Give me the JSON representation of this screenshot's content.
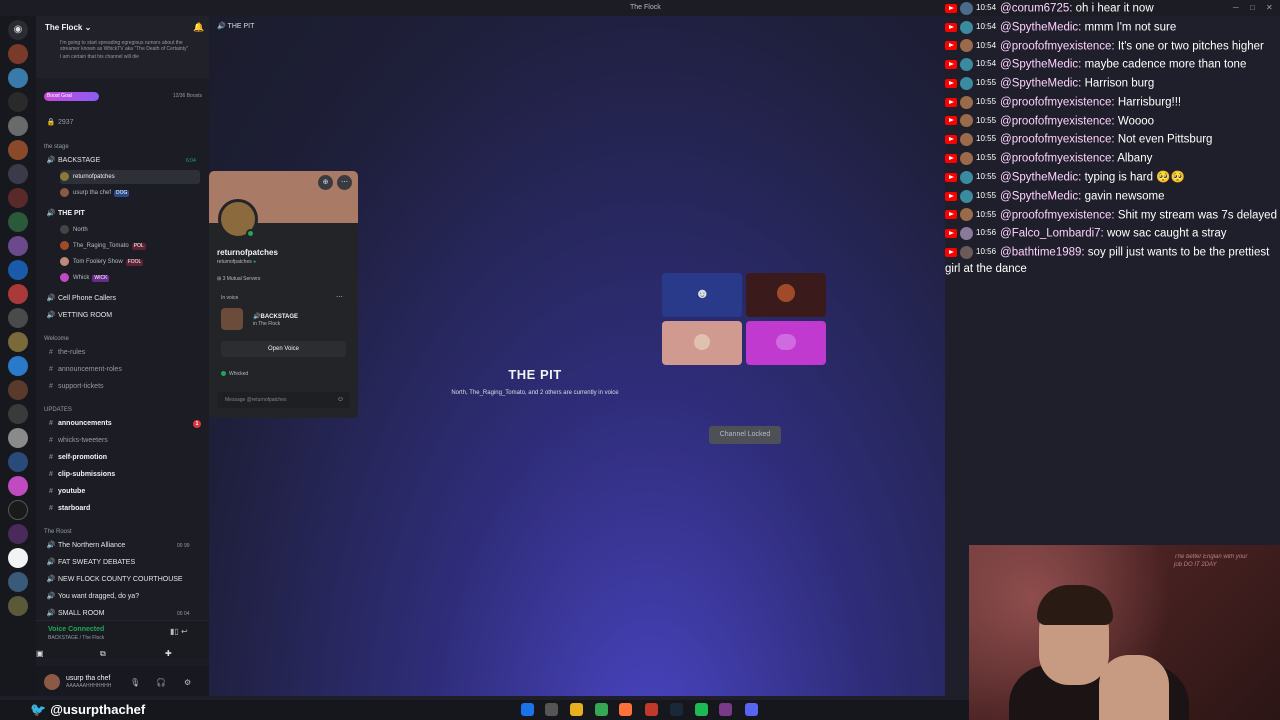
{
  "window": {
    "title": "The Flock"
  },
  "server": {
    "name": "The Flock",
    "event_text": "I'm going to start spreading egregious rumors about the streamer known as WhickTV aka \"The Death of Certainty\"",
    "event_text2": "I am certain that his channel will die",
    "boost_label": "Boost Goal",
    "boost_count": "12/36 Boosts",
    "boost_progress": 0.33
  },
  "sidebar": {
    "member_count": "2937",
    "cat_stage": "the stage",
    "backstage": {
      "label": "BACKSTAGE",
      "time": "6:04"
    },
    "backstage_users": [
      {
        "name": "returnofpatches",
        "tag": ""
      },
      {
        "name": "usurp tha chef",
        "tag": "DOG"
      }
    ],
    "thepit": {
      "label": "THE PIT"
    },
    "pit_users": [
      {
        "name": "North",
        "tag": ""
      },
      {
        "name": "The_Raging_Tomato",
        "tag": "POL"
      },
      {
        "name": "Tom Foolery Show",
        "tag": "FOOL"
      },
      {
        "name": "Whick",
        "tag": "WICK"
      }
    ],
    "voice_channels_a": [
      "Cell Phone Callers",
      "VETTING ROOM"
    ],
    "cat_welcome": "Welcome",
    "welcome_channels": [
      "the-rules",
      "announcement-roles",
      "support-tickets"
    ],
    "cat_updates": "UPDATES",
    "update_channels": [
      "announcements",
      "whicks-tweeters",
      "self-promotion",
      "clip-submissions",
      "youtube",
      "starboard"
    ],
    "cat_roost": "The Roost",
    "roost_channels": [
      "The Northern Alliance",
      "FAT SWEATY DEBATES",
      "NEW FLOCK COUNTY COURTHOUSE",
      "You want dragged, do ya?",
      "SMALL ROOM"
    ],
    "roost_counts": [
      "00 99",
      "00 04"
    ]
  },
  "voice": {
    "status": "Voice Connected",
    "location": "BACKSTAGE / The Flock"
  },
  "user": {
    "name": "usurp tha chef",
    "status": "AAAAAAHHHHHHH"
  },
  "main": {
    "channel": "THE PIT",
    "title": "THE PIT",
    "subtitle": "North, The_Raging_Tomato, and 2 others are currently in voice",
    "locked": "Channel Locked"
  },
  "popout": {
    "name": "returnofpatches",
    "handle": "returnofpatches",
    "mutual": "3 Mutual Servers",
    "in_voice_label": "In voice",
    "voice_channel": "BACKSTAGE",
    "voice_server": "in The Flock",
    "open_voice": "Open Voice",
    "activity": "Whicked",
    "message_placeholder": "Message @returnofpatches"
  },
  "chat": [
    {
      "ts": "10:54",
      "user": "@corum6725:",
      "msg": "oh i hear it now",
      "color": "#4a6b8a"
    },
    {
      "ts": "10:54",
      "user": "@SpytheMedic:",
      "msg": "mmm I'm not sure",
      "color": "#3a8aa0"
    },
    {
      "ts": "10:54",
      "user": "@proofofmyexistence:",
      "msg": "It's one or two pitches higher",
      "color": "#9a6a4a"
    },
    {
      "ts": "10:54",
      "user": "@SpytheMedic:",
      "msg": "maybe cadence more than tone",
      "color": "#3a8aa0"
    },
    {
      "ts": "10:55",
      "user": "@SpytheMedic:",
      "msg": "Harrison burg",
      "color": "#3a8aa0"
    },
    {
      "ts": "10:55",
      "user": "@proofofmyexistence:",
      "msg": "Harrisburg!!!",
      "color": "#9a6a4a"
    },
    {
      "ts": "10:55",
      "user": "@proofofmyexistence:",
      "msg": "Woooo",
      "color": "#9a6a4a"
    },
    {
      "ts": "10:55",
      "user": "@proofofmyexistence:",
      "msg": "Not even Pittsburg",
      "color": "#9a6a4a"
    },
    {
      "ts": "10:55",
      "user": "@proofofmyexistence:",
      "msg": "Albany",
      "color": "#9a6a4a"
    },
    {
      "ts": "10:55",
      "user": "@SpytheMedic:",
      "msg": "typing is hard 🥺🥺",
      "color": "#3a8aa0"
    },
    {
      "ts": "10:55",
      "user": "@SpytheMedic:",
      "msg": "gavin newsome",
      "color": "#3a8aa0"
    },
    {
      "ts": "10:55",
      "user": "@proofofmyexistence:",
      "msg": "Shit my stream was 7s delayed",
      "color": "#9a6a4a"
    },
    {
      "ts": "10:56",
      "user": "@Falco_Lombardi7:",
      "msg": "wow sac caught a stray",
      "color": "#8a7a9a"
    },
    {
      "ts": "10:56",
      "user": "@bathtime1989:",
      "msg": "soy pill just wants to be the prettiest girl at the dance",
      "color": "#6a5a5a"
    }
  ],
  "stream": {
    "handle": "@usurpthachef"
  },
  "cam": {
    "poster_text": "The better Englan with your job DO IT 2DAY"
  },
  "colors": {
    "accent": "#5865f2",
    "online": "#23a55a",
    "chat_user": "#ffd2ff",
    "youtube": "#ff0000"
  },
  "icons": [
    "discord-icon",
    "bell-icon",
    "speaker-icon",
    "hash-icon",
    "gear-icon",
    "headphones-icon",
    "mic-icon",
    "twitter-icon"
  ]
}
